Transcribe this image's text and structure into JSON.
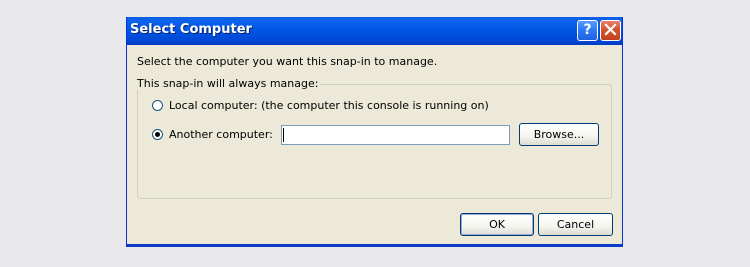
{
  "window": {
    "title": "Select Computer",
    "help_glyph": "?",
    "close_icon": "close-icon"
  },
  "prompt": "Select the computer you want this snap-in to manage.",
  "group": {
    "legend": "This snap-in will always manage:",
    "options": [
      {
        "label": "Local computer:  (the computer this console is running on)",
        "selected": false
      },
      {
        "label": "Another computer:",
        "selected": true
      }
    ],
    "computer_input_value": "",
    "browse_label": "Browse..."
  },
  "footer": {
    "ok_label": "OK",
    "cancel_label": "Cancel"
  },
  "colors": {
    "titlebar": "#0054e3",
    "dialog_bg": "#ece9d8",
    "close_button": "#d3542f"
  }
}
